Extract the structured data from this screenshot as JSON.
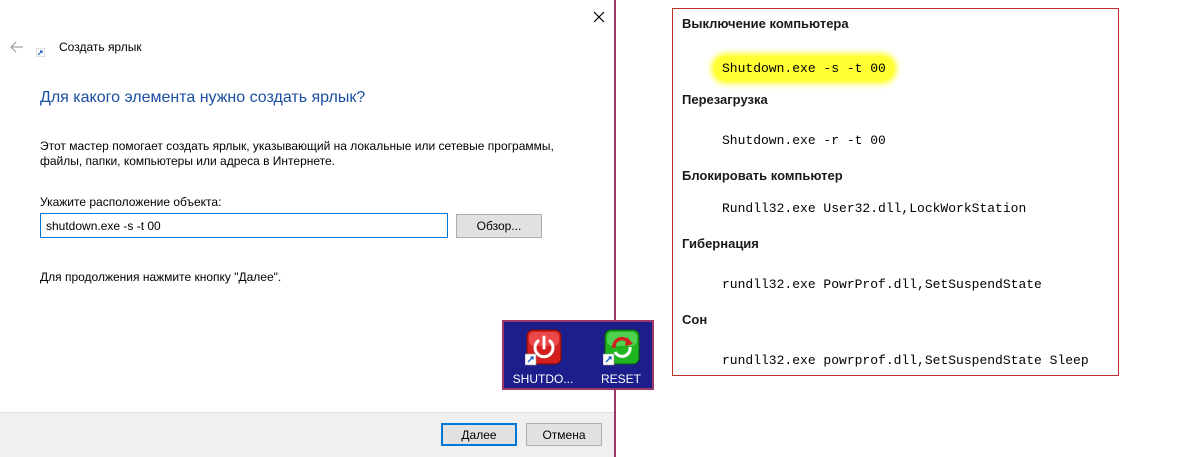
{
  "wizard": {
    "title": "Создать ярлык",
    "heading": "Для какого элемента нужно создать ярлык?",
    "description": "Этот мастер помогает создать ярлык, указывающий на локальные или сетевые программы, файлы, папки, компьютеры или адреса в Интернете.",
    "location_label": "Укажите расположение объекта:",
    "location_value": "shutdown.exe -s -t 00",
    "browse_label": "Обзор...",
    "continue_hint": "Для продолжения нажмите кнопку \"Далее\".",
    "next_label": "Далее",
    "cancel_label": "Отмена"
  },
  "desktop": {
    "shortcuts": [
      {
        "label": "SHUTDO...",
        "icon": "power-icon"
      },
      {
        "label": "RESET",
        "icon": "restart-icon"
      }
    ]
  },
  "commands": {
    "sections": [
      {
        "title": "Выключение компьютера",
        "command": "Shutdown.exe -s -t 00"
      },
      {
        "title": "Перезагрузка",
        "command": "Shutdown.exe -r -t 00"
      },
      {
        "title": "Блокировать компьютер",
        "command": "Rundll32.exe User32.dll,LockWorkStation"
      },
      {
        "title": "Гибернация",
        "command": "rundll32.exe PowrProf.dll,SetSuspendState"
      },
      {
        "title": "Сон",
        "command": "rundll32.exe powrprof.dll,SetSuspendState Sleep"
      }
    ]
  },
  "colors": {
    "heading_blue": "#1b4fa0",
    "highlight_yellow": "#ffff33",
    "panel_border_red": "#c0302b",
    "desktop_blue": "#1c1e8c"
  }
}
